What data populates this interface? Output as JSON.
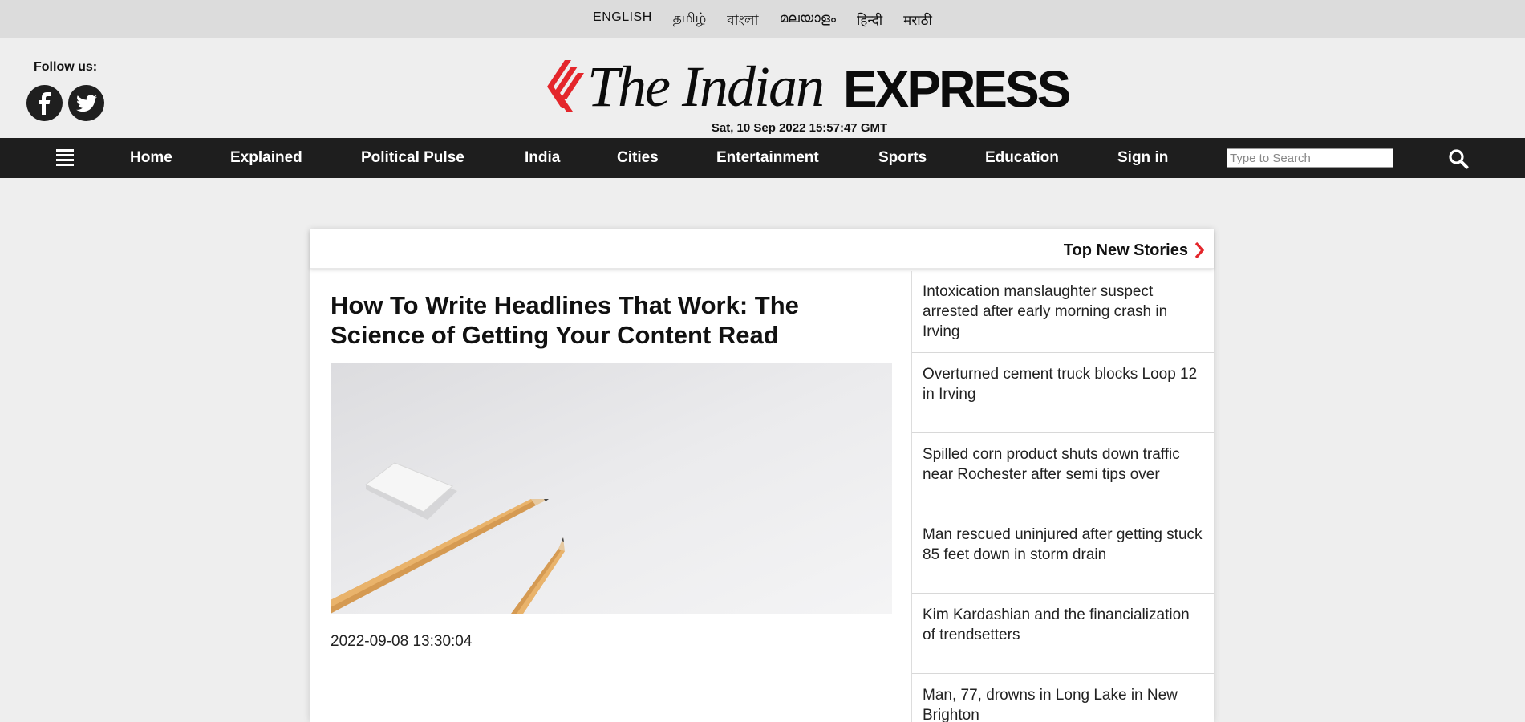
{
  "languages": [
    "ENGLISH",
    "தமிழ்",
    "বাংলা",
    "മലയാളം",
    "हिन्दी",
    "मराठी"
  ],
  "header": {
    "follow_label": "Follow us:",
    "logo_serif": "The Indian",
    "logo_sans": "EXPRESS",
    "datetime": "Sat, 10 Sep 2022 15:57:47 GMT"
  },
  "nav": {
    "items": [
      "Home",
      "Explained",
      "Political Pulse",
      "India",
      "Cities",
      "Entertainment",
      "Sports",
      "Education",
      "Sign in"
    ],
    "search_placeholder": "Type to Search"
  },
  "top_stories": {
    "label": "Top New Stories",
    "items": [
      "Intoxication manslaughter suspect arrested after early morning crash in Irving",
      "Overturned cement truck blocks Loop 12 in Irving",
      "Spilled corn product shuts down traffic near Rochester after semi tips over",
      "Man rescued uninjured after getting stuck 85 feet down in storm drain",
      "Kim Kardashian and the financialization of trendsetters",
      "Man, 77, drowns in Long Lake in New Brighton"
    ]
  },
  "article": {
    "headline": "How To Write Headlines That Work: The Science of Getting Your Content Read",
    "date": "2022-09-08 13:30:04"
  },
  "colors": {
    "nav_bg": "#1e1e1e",
    "accent_red": "#e4262b",
    "page_bg": "#eeeeee",
    "lang_bar_bg": "#dcdcdc"
  },
  "icons": [
    "facebook-icon",
    "twitter-icon",
    "hamburger-icon",
    "search-icon",
    "chevron-right-icon"
  ]
}
